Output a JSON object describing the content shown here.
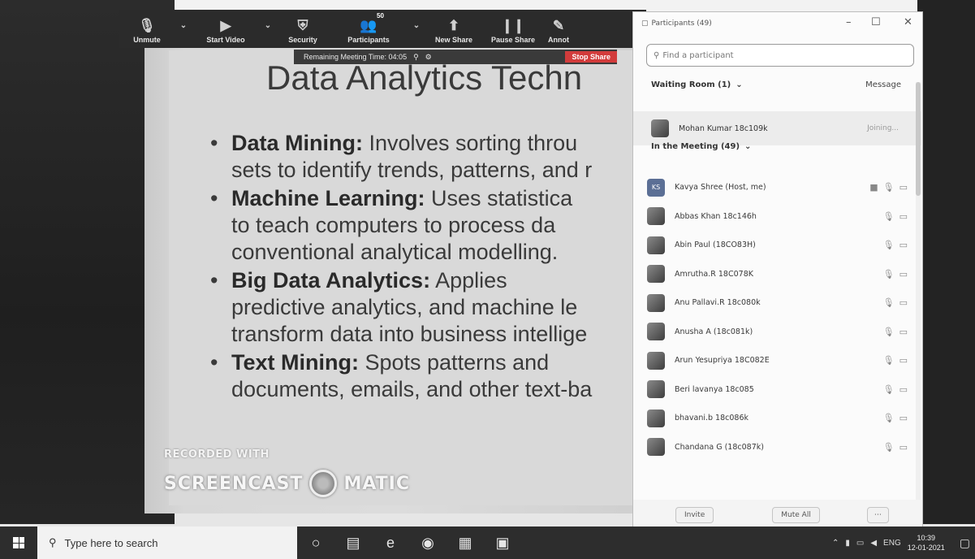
{
  "toolbar": {
    "unmute_label": "Unmute",
    "start_video_label": "Start Video",
    "security_label": "Security",
    "participants_label": "Participants",
    "participants_count": "50",
    "new_share_label": "New Share",
    "pause_share_label": "Pause Share",
    "annotate_label": "Annot"
  },
  "share_bar": {
    "remaining_time_text": "Remaining Meeting Time: 04:05",
    "stop_share_label": "Stop Share"
  },
  "slide": {
    "title": "Data Analytics Techn",
    "bullets": [
      {
        "term": "Data Mining:",
        "line1": " Involves sorting throu",
        "line2": "sets to identify trends, patterns, and r"
      },
      {
        "term": "Machine Learning:",
        "line1": " Uses statistica",
        "line2": "to teach computers to process da",
        "line3": "conventional analytical modelling."
      },
      {
        "term": "Big Data Analytics:",
        "line1": " Applies",
        "line2": "predictive analytics, and machine le",
        "line3": "transform data into business intellige"
      },
      {
        "term": "Text Mining:",
        "line1": " Spots patterns and",
        "line2": "documents, emails, and other text-ba"
      }
    ],
    "watermark_top": "RECORDED WITH",
    "watermark_left": "SCREENCAST",
    "watermark_right": "MATIC"
  },
  "panel": {
    "title": "Participants (49)",
    "search_placeholder": "Find a participant",
    "waiting_room_label": "Waiting Room (1)",
    "message_label": "Message",
    "waiting": {
      "name": "Mohan Kumar 18c109k",
      "status": "Joining..."
    },
    "in_meeting_label": "In the Meeting (49)",
    "participants": [
      {
        "name": "Kavya Shree (Host, me)",
        "initials": "KS"
      },
      {
        "name": "Abbas Khan 18c146h"
      },
      {
        "name": "Abin Paul (18CO83H)"
      },
      {
        "name": "Amrutha.R 18C078K"
      },
      {
        "name": "Anu Pallavi.R 18c080k"
      },
      {
        "name": "Anusha A (18c081k)"
      },
      {
        "name": "Arun Yesupriya 18C082E"
      },
      {
        "name": "Beri lavanya 18c085"
      },
      {
        "name": "bhavani.b 18c086k"
      },
      {
        "name": "Chandana G (18c087k)"
      }
    ],
    "invite_label": "Invite",
    "mute_all_label": "Mute All"
  },
  "taskbar": {
    "search_placeholder": "Type here to search",
    "language": "ENG",
    "time": "10:39",
    "date": "12-01-2021"
  }
}
